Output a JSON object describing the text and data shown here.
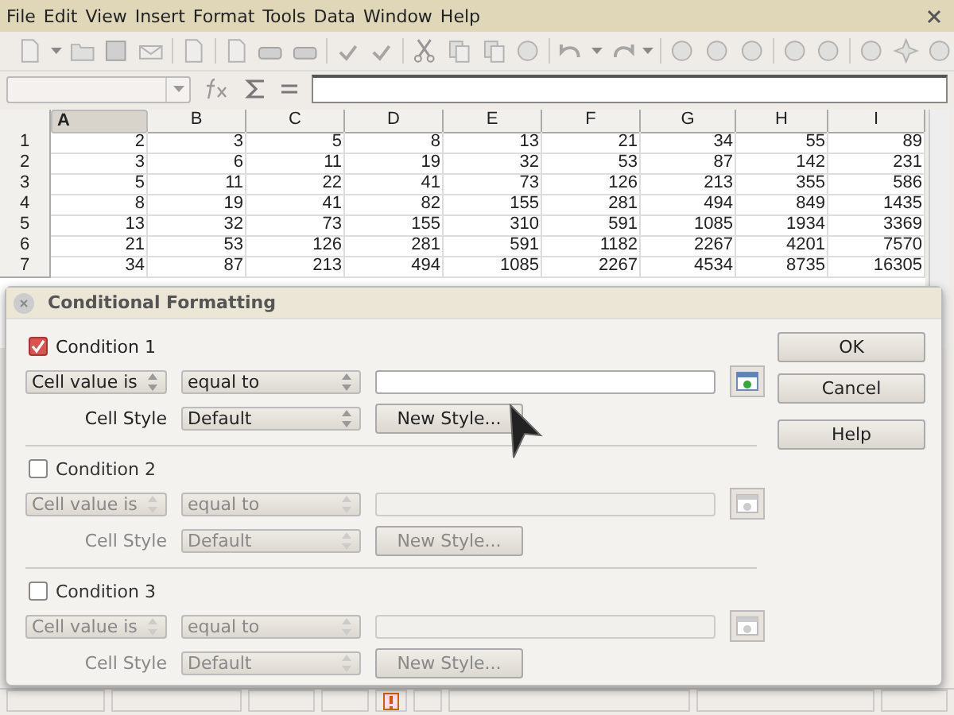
{
  "menu": [
    "File",
    "Edit",
    "View",
    "Insert",
    "Format",
    "Tools",
    "Data",
    "Window",
    "Help"
  ],
  "sheet": {
    "columns": [
      {
        "label": "A",
        "selected": true
      },
      {
        "label": "B",
        "selected": false
      },
      {
        "label": "C",
        "selected": false
      },
      {
        "label": "D",
        "selected": false
      },
      {
        "label": "E",
        "selected": false
      },
      {
        "label": "F",
        "selected": false
      },
      {
        "label": "G",
        "selected": false
      },
      {
        "label": "H",
        "selected": false
      },
      {
        "label": "I",
        "selected": false
      }
    ],
    "rows": [
      {
        "header": "1",
        "cells": [
          "2",
          "3",
          "5",
          "8",
          "13",
          "21",
          "34",
          "55",
          "89"
        ]
      },
      {
        "header": "2",
        "cells": [
          "3",
          "6",
          "11",
          "19",
          "32",
          "53",
          "87",
          "142",
          "231"
        ]
      },
      {
        "header": "3",
        "cells": [
          "5",
          "11",
          "22",
          "41",
          "73",
          "126",
          "213",
          "355",
          "586"
        ]
      },
      {
        "header": "4",
        "cells": [
          "8",
          "19",
          "41",
          "82",
          "155",
          "281",
          "494",
          "849",
          "1435"
        ]
      },
      {
        "header": "5",
        "cells": [
          "13",
          "32",
          "73",
          "155",
          "310",
          "591",
          "1085",
          "1934",
          "3369"
        ]
      },
      {
        "header": "6",
        "cells": [
          "21",
          "53",
          "126",
          "281",
          "591",
          "1182",
          "2267",
          "4201",
          "7570"
        ]
      },
      {
        "header": "7",
        "cells": [
          "34",
          "87",
          "213",
          "494",
          "1085",
          "2267",
          "4534",
          "8735",
          "16305"
        ]
      }
    ]
  },
  "dialog": {
    "title": "Conditional Formatting",
    "conditions": [
      {
        "label": "Condition 1",
        "checked": true,
        "type": "Cell value is",
        "operator": "equal to",
        "style_label": "Cell Style",
        "style": "Default",
        "new_style": "New Style..."
      },
      {
        "label": "Condition 2",
        "checked": false,
        "type": "Cell value is",
        "operator": "equal to",
        "style_label": "Cell Style",
        "style": "Default",
        "new_style": "New Style..."
      },
      {
        "label": "Condition 3",
        "checked": false,
        "type": "Cell value is",
        "operator": "equal to",
        "style_label": "Cell Style",
        "style": "Default",
        "new_style": "New Style..."
      }
    ],
    "buttons": [
      "OK",
      "Cancel",
      "Help"
    ]
  }
}
